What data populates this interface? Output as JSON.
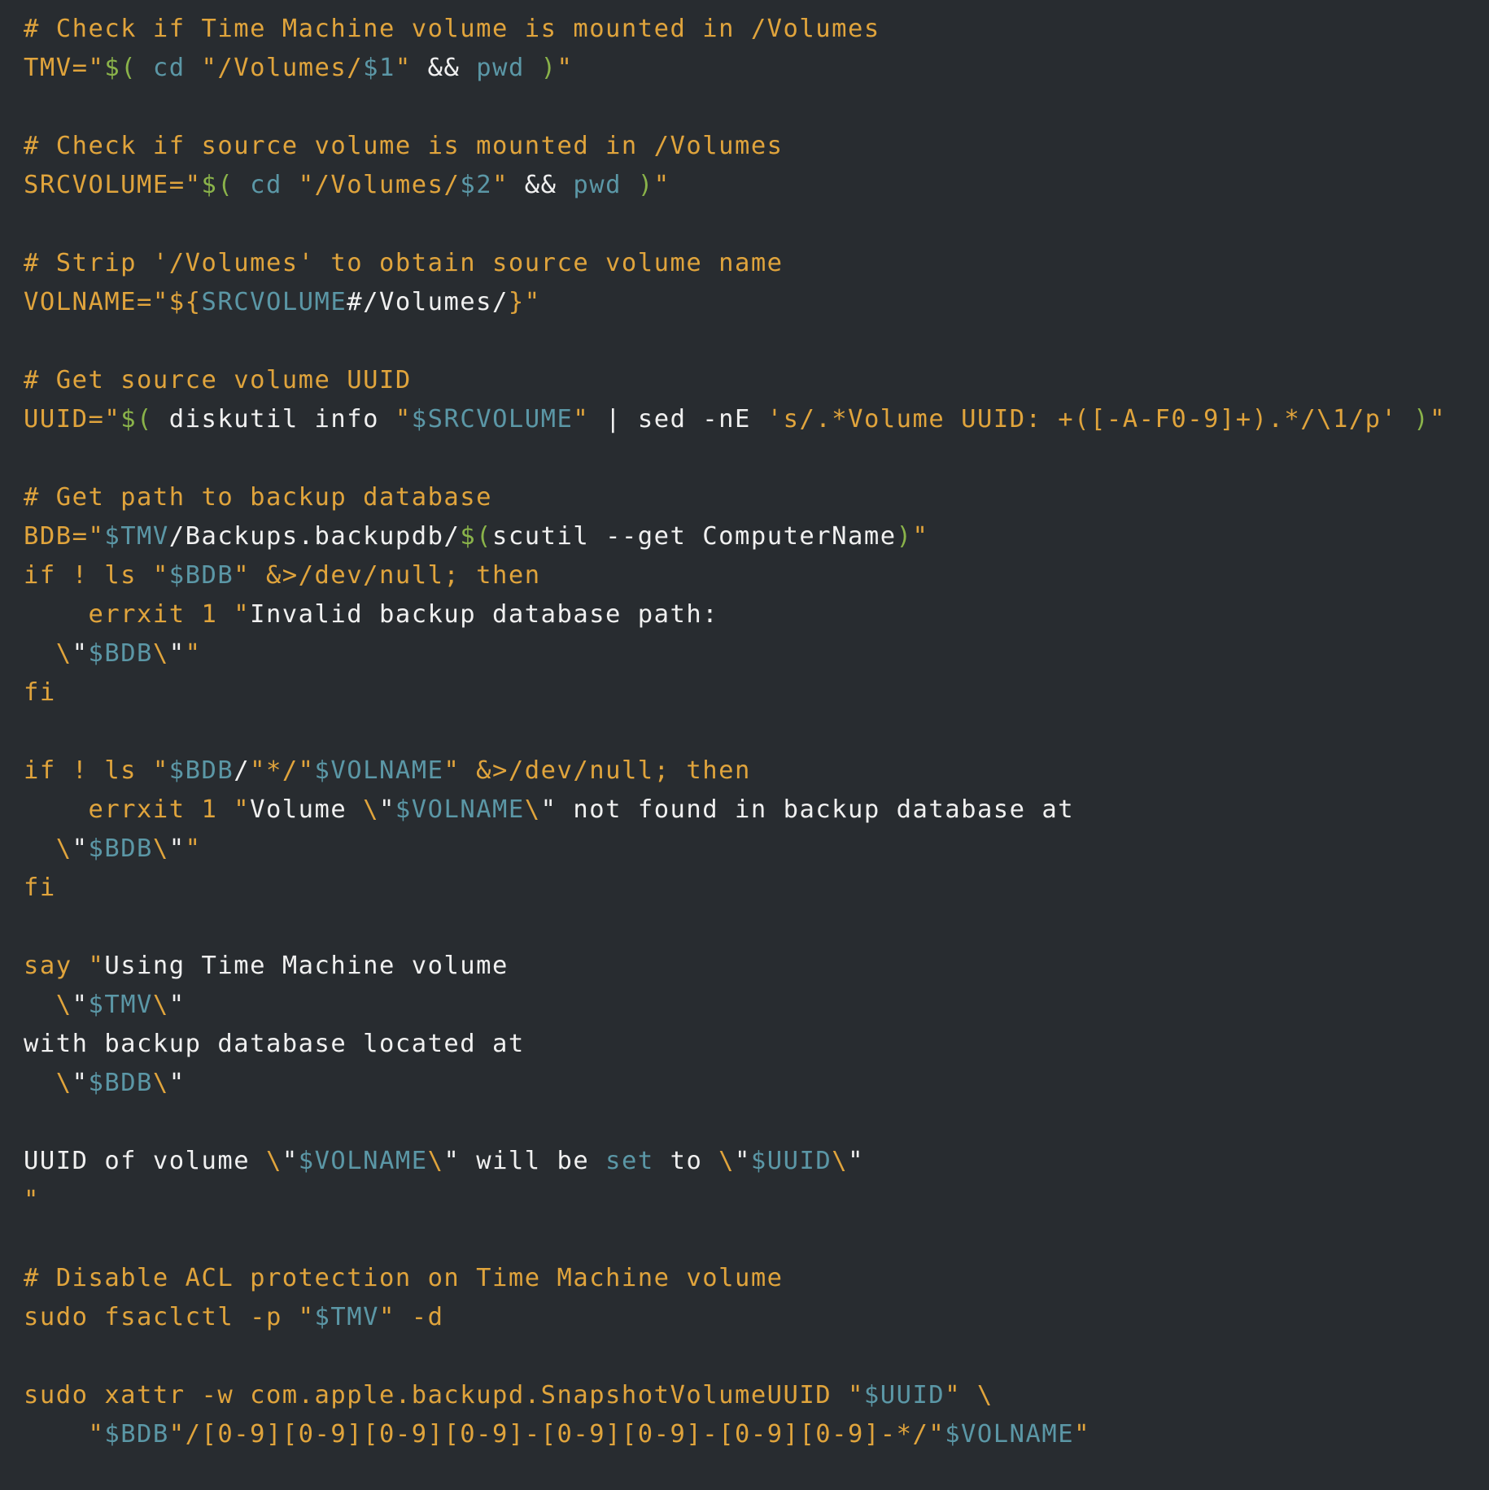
{
  "editor": {
    "theme_colors": {
      "background": "#282c30",
      "orange": "#e0a43c",
      "blue": "#5b97a6",
      "green": "#8ab34a",
      "white": "#f0f0f0"
    },
    "lines": [
      [
        [
          "o",
          "# Check if Time Machine volume is mounted in /Volumes"
        ]
      ],
      [
        [
          "o",
          "TMV=\""
        ],
        [
          "g",
          "$("
        ],
        [
          "b",
          " cd "
        ],
        [
          "o",
          "\"/Volumes/"
        ],
        [
          "b",
          "$1"
        ],
        [
          "o",
          "\""
        ],
        [
          "w",
          " && "
        ],
        [
          "b",
          "pwd "
        ],
        [
          "g",
          ")"
        ],
        [
          "o",
          "\""
        ]
      ],
      [],
      [
        [
          "o",
          "# Check if source volume is mounted in /Volumes"
        ]
      ],
      [
        [
          "o",
          "SRCVOLUME=\""
        ],
        [
          "g",
          "$("
        ],
        [
          "b",
          " cd "
        ],
        [
          "o",
          "\"/Volumes/"
        ],
        [
          "b",
          "$2"
        ],
        [
          "o",
          "\""
        ],
        [
          "w",
          " && "
        ],
        [
          "b",
          "pwd "
        ],
        [
          "g",
          ")"
        ],
        [
          "o",
          "\""
        ]
      ],
      [],
      [
        [
          "o",
          "# Strip '/Volumes' to obtain source volume name"
        ]
      ],
      [
        [
          "o",
          "VOLNAME=\"${"
        ],
        [
          "b",
          "SRCVOLUME"
        ],
        [
          "w",
          "#/Volumes/"
        ],
        [
          "o",
          "}\""
        ]
      ],
      [],
      [
        [
          "o",
          "# Get source volume UUID"
        ]
      ],
      [
        [
          "o",
          "UUID=\""
        ],
        [
          "g",
          "$("
        ],
        [
          "w",
          " diskutil info "
        ],
        [
          "o",
          "\""
        ],
        [
          "b",
          "$SRCVOLUME"
        ],
        [
          "o",
          "\""
        ],
        [
          "w",
          " | sed -nE "
        ],
        [
          "o",
          "'s/.*Volume UUID: +([-A-F0-9]+).*/\\1/p' "
        ],
        [
          "g",
          ")"
        ],
        [
          "o",
          "\""
        ]
      ],
      [],
      [
        [
          "o",
          "# Get path to backup database"
        ]
      ],
      [
        [
          "o",
          "BDB=\""
        ],
        [
          "b",
          "$TMV"
        ],
        [
          "w",
          "/Backups.backupdb/"
        ],
        [
          "g",
          "$("
        ],
        [
          "w",
          "scutil --get ComputerName"
        ],
        [
          "g",
          ")"
        ],
        [
          "o",
          "\""
        ]
      ],
      [
        [
          "o",
          "if ! ls \""
        ],
        [
          "b",
          "$BDB"
        ],
        [
          "o",
          "\" &>/dev/null; then"
        ]
      ],
      [
        [
          "o",
          "    errxit 1 \""
        ],
        [
          "w",
          "Invalid backup database path:"
        ]
      ],
      [
        [
          "o",
          "  \\"
        ],
        [
          "w",
          "\""
        ],
        [
          "b",
          "$BDB"
        ],
        [
          "o",
          "\\"
        ],
        [
          "w",
          "\""
        ],
        [
          "o",
          "\""
        ]
      ],
      [
        [
          "o",
          "fi"
        ]
      ],
      [],
      [
        [
          "o",
          "if ! ls \""
        ],
        [
          "b",
          "$BDB"
        ],
        [
          "w",
          "/"
        ],
        [
          "o",
          "\"*/\""
        ],
        [
          "b",
          "$VOLNAME"
        ],
        [
          "o",
          "\" &>/dev/null; then"
        ]
      ],
      [
        [
          "o",
          "    errxit 1 \""
        ],
        [
          "w",
          "Volume "
        ],
        [
          "o",
          "\\"
        ],
        [
          "w",
          "\""
        ],
        [
          "b",
          "$VOLNAME"
        ],
        [
          "o",
          "\\"
        ],
        [
          "w",
          "\" not found in backup database at"
        ]
      ],
      [
        [
          "o",
          "  \\"
        ],
        [
          "w",
          "\""
        ],
        [
          "b",
          "$BDB"
        ],
        [
          "o",
          "\\"
        ],
        [
          "w",
          "\""
        ],
        [
          "o",
          "\""
        ]
      ],
      [
        [
          "o",
          "fi"
        ]
      ],
      [],
      [
        [
          "o",
          "say \""
        ],
        [
          "w",
          "Using Time Machine volume"
        ]
      ],
      [
        [
          "o",
          "  \\"
        ],
        [
          "w",
          "\""
        ],
        [
          "b",
          "$TMV"
        ],
        [
          "o",
          "\\"
        ],
        [
          "w",
          "\""
        ]
      ],
      [
        [
          "w",
          "with backup database located at"
        ]
      ],
      [
        [
          "o",
          "  \\"
        ],
        [
          "w",
          "\""
        ],
        [
          "b",
          "$BDB"
        ],
        [
          "o",
          "\\"
        ],
        [
          "w",
          "\""
        ]
      ],
      [],
      [
        [
          "w",
          "UUID of volume "
        ],
        [
          "o",
          "\\"
        ],
        [
          "w",
          "\""
        ],
        [
          "b",
          "$VOLNAME"
        ],
        [
          "o",
          "\\"
        ],
        [
          "w",
          "\" will be "
        ],
        [
          "b",
          "set"
        ],
        [
          "w",
          " to "
        ],
        [
          "o",
          "\\"
        ],
        [
          "w",
          "\""
        ],
        [
          "b",
          "$UUID"
        ],
        [
          "o",
          "\\"
        ],
        [
          "w",
          "\""
        ]
      ],
      [
        [
          "o",
          "\""
        ]
      ],
      [],
      [
        [
          "o",
          "# Disable ACL protection on Time Machine volume"
        ]
      ],
      [
        [
          "o",
          "sudo fsaclctl -p \""
        ],
        [
          "b",
          "$TMV"
        ],
        [
          "o",
          "\" -d"
        ]
      ],
      [],
      [
        [
          "o",
          "sudo xattr -w com.apple.backupd.SnapshotVolumeUUID \""
        ],
        [
          "b",
          "$UUID"
        ],
        [
          "o",
          "\" \\"
        ]
      ],
      [
        [
          "o",
          "    \""
        ],
        [
          "b",
          "$BDB"
        ],
        [
          "o",
          "\"/[0-9][0-9][0-9][0-9]-[0-9][0-9]-[0-9][0-9]-*/\""
        ],
        [
          "b",
          "$VOLNAME"
        ],
        [
          "o",
          "\""
        ]
      ]
    ]
  }
}
